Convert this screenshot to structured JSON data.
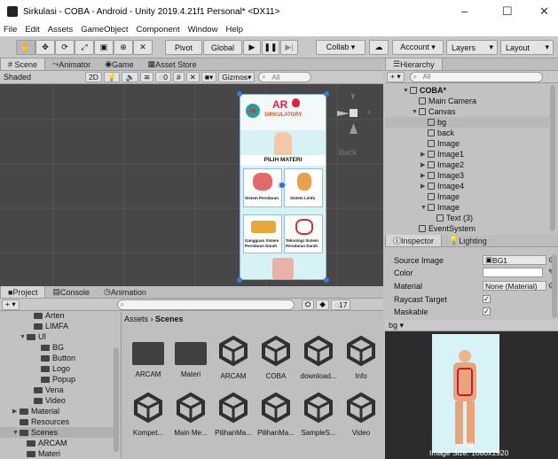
{
  "window": {
    "title": "Sirkulasi - COBA - Android - Unity 2019.4.21f1 Personal* <DX11>",
    "minimize": "–",
    "maximize": "☐",
    "close": "✕"
  },
  "menu": [
    "File",
    "Edit",
    "Assets",
    "GameObject",
    "Component",
    "Window",
    "Help"
  ],
  "toolbar": {
    "pivot": "Pivot",
    "global": "Global",
    "collab": "Collab ▾",
    "account": "Account ▾",
    "layers": "Layers",
    "layout": "Layout"
  },
  "scene_tabs": {
    "scene": "# Scene",
    "animator": "Animator",
    "game": "Game",
    "asset_store": "Asset Store"
  },
  "scene_controls": {
    "shading": "Shaded",
    "mode2d": "2D",
    "gizmos": "Gizmos",
    "search_placeholder": "All",
    "count": "0"
  },
  "gizmo": {
    "y": "y",
    "x": "x",
    "back": "Back"
  },
  "phone": {
    "title_main": "AR",
    "title_sub": "SIRKULATORY",
    "pilih": "PILIH MATERI",
    "card1": "Sistem Peredaran",
    "card2": "Sistem Limfa",
    "card3": "Gangguan Sistem Peredaran Darah",
    "card4": "Teknologi Sistem Peredaran Darah"
  },
  "hierarchy": {
    "tab": "Hierarchy",
    "search_placeholder": "All",
    "items": [
      {
        "label": "COBA*",
        "indent": 0,
        "arrow": "▼"
      },
      {
        "label": "Main Camera",
        "indent": 1,
        "arrow": ""
      },
      {
        "label": "Canvas",
        "indent": 1,
        "arrow": "▼"
      },
      {
        "label": "bg",
        "indent": 2,
        "arrow": "",
        "selected": true
      },
      {
        "label": "back",
        "indent": 2,
        "arrow": ""
      },
      {
        "label": "Image",
        "indent": 2,
        "arrow": ""
      },
      {
        "label": "Image1",
        "indent": 2,
        "arrow": "▶"
      },
      {
        "label": "Image2",
        "indent": 2,
        "arrow": "▶"
      },
      {
        "label": "Image3",
        "indent": 2,
        "arrow": "▶"
      },
      {
        "label": "Image4",
        "indent": 2,
        "arrow": "▶"
      },
      {
        "label": "Image",
        "indent": 2,
        "arrow": ""
      },
      {
        "label": "Image",
        "indent": 2,
        "arrow": "▼"
      },
      {
        "label": "Text (3)",
        "indent": 3,
        "arrow": ""
      },
      {
        "label": "EventSystem",
        "indent": 1,
        "arrow": ""
      }
    ]
  },
  "inspector": {
    "tab": "Inspector",
    "lighting": "Lighting",
    "rows": [
      {
        "label": "Source Image",
        "value": "BG1"
      },
      {
        "label": "Color",
        "value": ""
      },
      {
        "label": "Material",
        "value": "None (Material)"
      },
      {
        "label": "Raycast Target",
        "value": "✓"
      },
      {
        "label": "Maskable",
        "value": "✓"
      }
    ],
    "preview_label": "bg ▾",
    "preview_name": "bg",
    "image_size": "Image Size: 1080x1920"
  },
  "project": {
    "tabs": {
      "project": "Project",
      "console": "Console",
      "animation": "Animation"
    },
    "hidden_count": "17",
    "breadcrumb": "Assets",
    "breadcrumb_current": "Scenes",
    "tree": [
      {
        "label": "Arten",
        "indent": 3
      },
      {
        "label": "LIMFA",
        "indent": 3
      },
      {
        "label": "UI",
        "indent": 2,
        "arrow": "▼"
      },
      {
        "label": "BG",
        "indent": 4
      },
      {
        "label": "Button",
        "indent": 4
      },
      {
        "label": "Logo",
        "indent": 4
      },
      {
        "label": "Popup",
        "indent": 4
      },
      {
        "label": "Vena",
        "indent": 3
      },
      {
        "label": "Video",
        "indent": 3
      },
      {
        "label": "Material",
        "indent": 1,
        "arrow": "▶"
      },
      {
        "label": "Resources",
        "indent": 1
      },
      {
        "label": "Scenes",
        "indent": 1,
        "arrow": "▼",
        "selected": true
      },
      {
        "label": "ARCAM",
        "indent": 2
      },
      {
        "label": "Materi",
        "indent": 2
      }
    ],
    "assets": [
      {
        "label": "ARCAM",
        "kind": "folder"
      },
      {
        "label": "Materi",
        "kind": "folder"
      },
      {
        "label": "ARCAM",
        "kind": "unity"
      },
      {
        "label": "COBA",
        "kind": "unity"
      },
      {
        "label": "download...",
        "kind": "unity"
      },
      {
        "label": "Info",
        "kind": "unity"
      },
      {
        "label": "Kompet...",
        "kind": "unity"
      },
      {
        "label": "Main Me...",
        "kind": "unity"
      },
      {
        "label": "PilihanMa...",
        "kind": "unity"
      },
      {
        "label": "PilihanMa...",
        "kind": "unity"
      },
      {
        "label": "SampleS...",
        "kind": "unity"
      },
      {
        "label": "Video",
        "kind": "unity"
      }
    ]
  }
}
